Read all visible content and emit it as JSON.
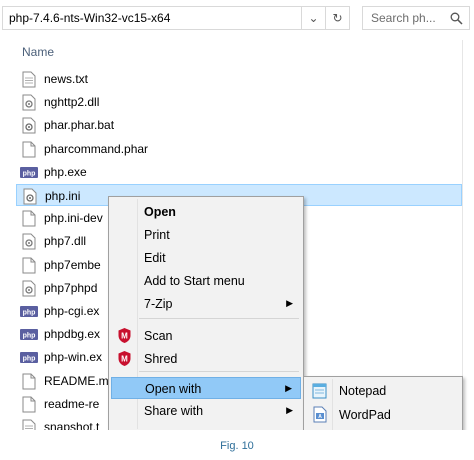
{
  "address": {
    "path": "php-7.4.6-nts-Win32-vc15-x64",
    "dropdown_icon": "chevron-down-icon",
    "refresh_icon": "refresh-icon"
  },
  "search": {
    "placeholder": "Search ph..."
  },
  "columns": {
    "name": "Name"
  },
  "files": [
    {
      "name": "news.txt",
      "icon": "text-file"
    },
    {
      "name": "nghttp2.dll",
      "icon": "dll-file"
    },
    {
      "name": "phar.phar.bat",
      "icon": "bat-file"
    },
    {
      "name": "pharcommand.phar",
      "icon": "blank-file"
    },
    {
      "name": "php.exe",
      "icon": "php-exe"
    },
    {
      "name": "php.ini",
      "icon": "ini-file",
      "selected": true
    },
    {
      "name": "php.ini-dev",
      "icon": "blank-file"
    },
    {
      "name": "php7.dll",
      "icon": "dll-file"
    },
    {
      "name": "php7embe",
      "icon": "blank-file"
    },
    {
      "name": "php7phpd",
      "icon": "dll-file"
    },
    {
      "name": "php-cgi.ex",
      "icon": "php-exe"
    },
    {
      "name": "phpdbg.ex",
      "icon": "php-exe"
    },
    {
      "name": "php-win.ex",
      "icon": "php-exe"
    },
    {
      "name": "README.m",
      "icon": "blank-file"
    },
    {
      "name": "readme-re",
      "icon": "blank-file"
    },
    {
      "name": "snapshot.t",
      "icon": "text-file"
    }
  ],
  "context_menu": {
    "items": [
      {
        "label": "Open",
        "bold": true
      },
      {
        "label": "Print"
      },
      {
        "label": "Edit"
      },
      {
        "label": "Add to Start menu"
      },
      {
        "label": "7-Zip",
        "submenu": true
      },
      {
        "label": "Scan",
        "icon": "mcafee-icon"
      },
      {
        "label": "Shred",
        "icon": "mcafee-icon"
      },
      {
        "label": "Open with",
        "submenu": true,
        "highlighted": true
      },
      {
        "label": "Share with",
        "submenu": true
      }
    ]
  },
  "open_with_menu": {
    "items": [
      {
        "label": "Notepad",
        "icon": "notepad-icon"
      },
      {
        "label": "WordPad",
        "icon": "wordpad-icon"
      }
    ]
  },
  "caption": "Fig. 10",
  "colors": {
    "selection": "#cce8ff",
    "menu_highlight": "#91c9f7",
    "caption": "#2f6f9a"
  }
}
